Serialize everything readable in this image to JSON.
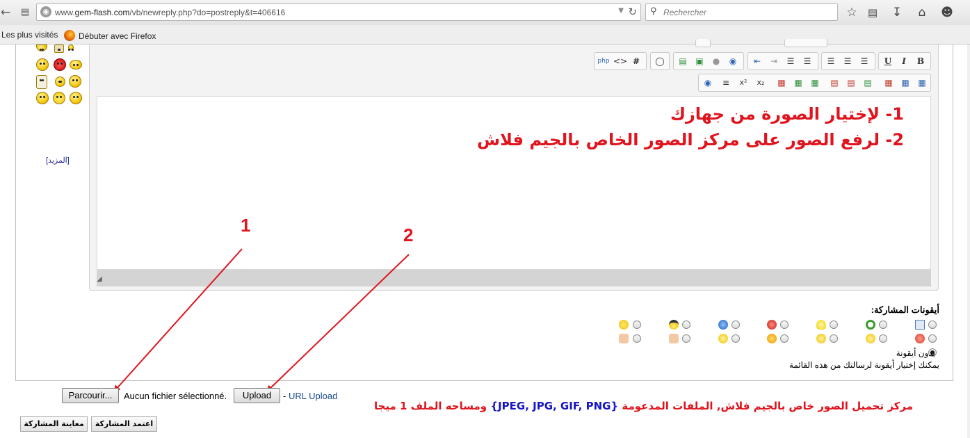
{
  "browser": {
    "url_prefix": "www.",
    "url_domain": "gem-flash.com",
    "url_path": "/vb/newreply.php?do=postreply&t=406616",
    "search_placeholder": "Rechercher",
    "bookmarks": [
      "Les plus visités",
      "Débuter avec Firefox"
    ]
  },
  "sidebar": {
    "more_link": "[المزيد]"
  },
  "editor": {
    "line1": "1- لإختيار الصورة من جهازك",
    "line2": "2- لرفع الصور على مركز الصور الخاص بالجيم فلاش"
  },
  "annotations": {
    "arrow1_label": "1",
    "arrow2_label": "2"
  },
  "post_icons": {
    "title": "أيقونات المشاركة:",
    "no_icon_label": "بدون أيقونة",
    "note": "يمكنك إختيار أيقونة لرسالتك من هذه القائمة",
    "selected": "none"
  },
  "upload": {
    "browse_button": "Parcourir...",
    "no_file": "Aucun fichier sélectionné.",
    "upload_button": "Upload",
    "dash": "-",
    "url_upload_link": "URL Upload",
    "info_prefix": "مركز تحميل الصور خاص بالجيم فلاش, الملفات المدعومة",
    "info_formats": "{JPEG, JPG, GIF, PNG}",
    "info_suffix": "ومساحه الملف 1 ميجا"
  },
  "actions": {
    "submit": "اعتمد المشاركة",
    "preview": "معاينة المشاركة"
  },
  "colors": {
    "annotation_red": "#e0141d",
    "formats_blue": "#1616c2",
    "link_blue": "#1a4b8c"
  }
}
